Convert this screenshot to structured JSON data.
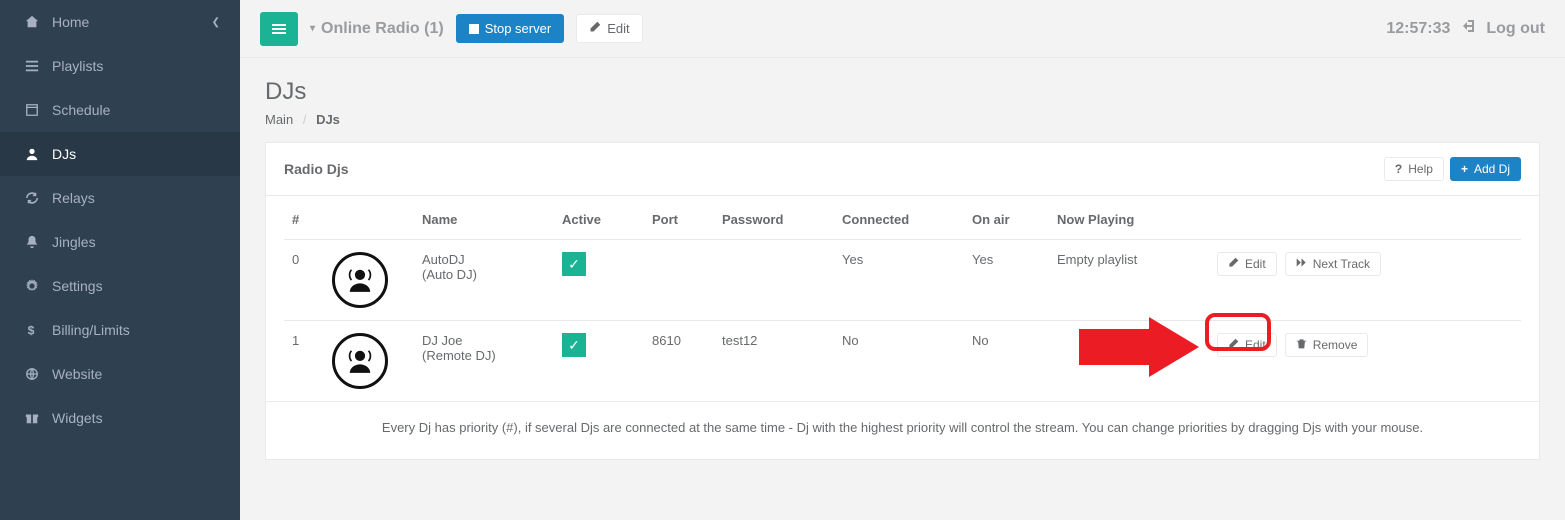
{
  "sidebar": {
    "items": [
      {
        "label": "Home"
      },
      {
        "label": "Playlists"
      },
      {
        "label": "Schedule"
      },
      {
        "label": "DJs"
      },
      {
        "label": "Relays"
      },
      {
        "label": "Jingles"
      },
      {
        "label": "Settings"
      },
      {
        "label": "Billing/Limits"
      },
      {
        "label": "Website"
      },
      {
        "label": "Widgets"
      }
    ]
  },
  "topbar": {
    "station_name": "Online Radio (1)",
    "stop_server": "Stop server",
    "edit": "Edit",
    "clock": "12:57:33",
    "logout": "Log out"
  },
  "page": {
    "title": "DJs",
    "breadcrumb_root": "Main",
    "breadcrumb_current": "DJs"
  },
  "panel": {
    "title": "Radio Djs",
    "help": "Help",
    "add": "Add Dj"
  },
  "table": {
    "headers": {
      "num": "#",
      "name": "Name",
      "active": "Active",
      "port": "Port",
      "password": "Password",
      "connected": "Connected",
      "onair": "On air",
      "nowplaying": "Now Playing"
    },
    "rows": [
      {
        "num": "0",
        "name": "AutoDJ",
        "type": "(Auto DJ)",
        "active": true,
        "port": "",
        "password": "",
        "connected": "Yes",
        "onair": "Yes",
        "nowplaying": "Empty playlist",
        "action_edit": "Edit",
        "action_next": "Next Track"
      },
      {
        "num": "1",
        "name": "DJ Joe",
        "type": "(Remote DJ)",
        "active": true,
        "port": "8610",
        "password": "test12",
        "connected": "No",
        "onair": "No",
        "nowplaying": "",
        "action_edit": "Edit",
        "action_remove": "Remove"
      }
    ],
    "hint": "Every Dj has priority (#), if several Djs are connected at the same time - Dj with the highest priority will control the stream. You can change priorities by dragging Djs with your mouse."
  },
  "icons": {
    "plus": "+",
    "question": "?"
  }
}
